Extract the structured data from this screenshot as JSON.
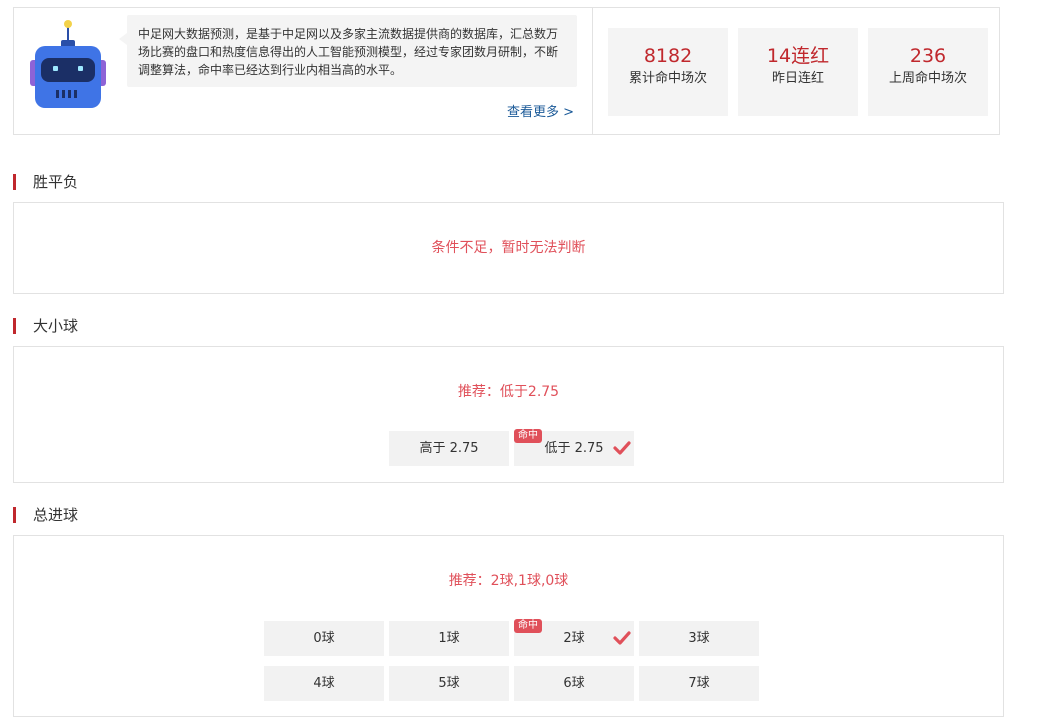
{
  "intro": {
    "description": "中足网大数据预测，是基于中足网以及多家主流数据提供商的数据库，汇总数万场比赛的盘口和热度信息得出的人工智能预测模型，经过专家团数月研制，不断调整算法，命中率已经达到行业内相当高的水平。",
    "more_link": "查看更多 >",
    "stats": [
      {
        "value": "8182",
        "label": "累计命中场次"
      },
      {
        "value": "14连红",
        "label": "昨日连红"
      },
      {
        "value": "236",
        "label": "上周命中场次"
      }
    ]
  },
  "sections": {
    "wdl": {
      "title": "胜平负",
      "message": "条件不足，暂时无法判断"
    },
    "ou": {
      "title": "大小球",
      "recommendation": "推荐：低于2.75",
      "options": [
        {
          "label": "高于 2.75",
          "hit": false
        },
        {
          "label": "低于 2.75",
          "hit": true
        }
      ]
    },
    "goals": {
      "title": "总进球",
      "recommendation": "推荐：2球,1球,0球",
      "options": [
        {
          "label": "0球",
          "hit": false
        },
        {
          "label": "1球",
          "hit": false
        },
        {
          "label": "2球",
          "hit": true
        },
        {
          "label": "3球",
          "hit": false
        },
        {
          "label": "4球",
          "hit": false
        },
        {
          "label": "5球",
          "hit": false
        },
        {
          "label": "6球",
          "hit": false
        },
        {
          "label": "7球",
          "hit": false
        }
      ]
    }
  },
  "hit_badge": "命中",
  "colors": {
    "accent": "#c0282d",
    "recommend": "#e0505a",
    "link": "#1b5a98",
    "robot": "#3f74e6"
  }
}
